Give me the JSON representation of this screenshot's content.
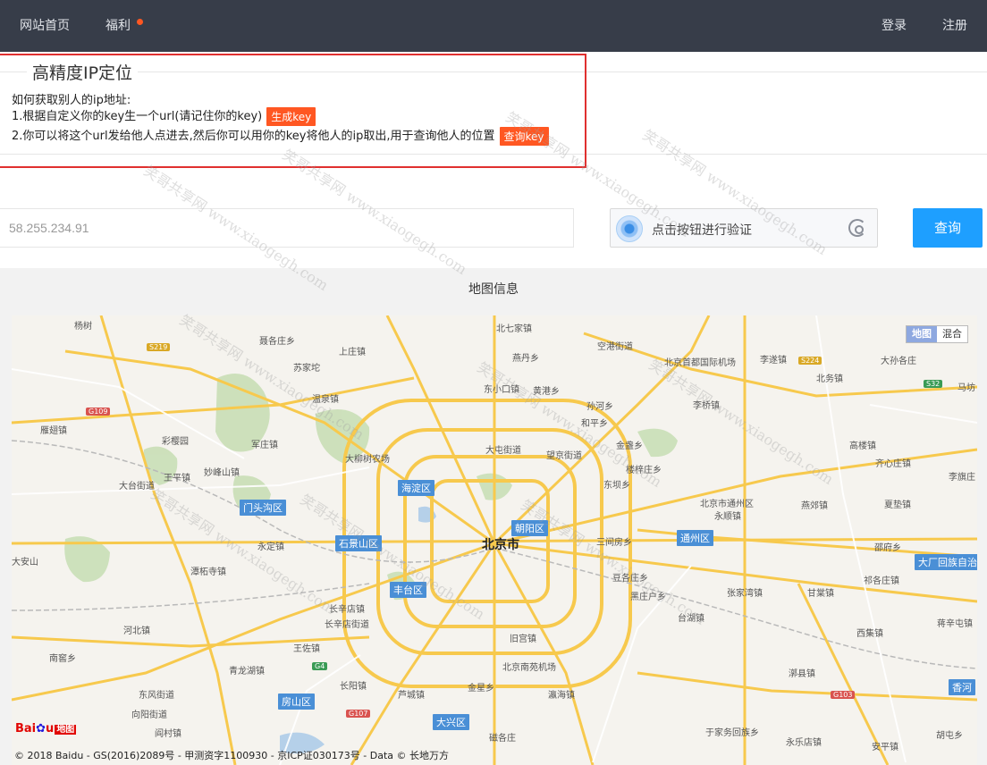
{
  "nav": {
    "home": "网站首页",
    "welfare": "福利",
    "login": "登录",
    "register": "注册"
  },
  "intro": {
    "title": "高精度IP定位",
    "question": "如何获取别人的ip地址:",
    "step1": "1.根据自定义你的key生一个url(请记住你的key)",
    "step1_button": "生成key",
    "step2": "2.你可以将这个url发给他人点进去,然后你可以用你的key将他人的ip取出,用于查询他人的位置",
    "step2_button": "查询key"
  },
  "query": {
    "ip_value": "58.255.234.91",
    "captcha_text": "点击按钮进行验证",
    "search_button": "查询"
  },
  "map": {
    "title": "地图信息",
    "type_map": "地图",
    "type_hybrid": "混合",
    "center_city": "北京市",
    "districts": [
      "海淀区",
      "门头沟区",
      "石景山区",
      "朝阳区",
      "丰台区",
      "通州区",
      "房山区",
      "大兴区",
      "大厂回族自治",
      "香河"
    ],
    "places": [
      "杨树",
      "北七家镇",
      "空港街道",
      "燕丹乡",
      "聂各庄乡",
      "上庄镇",
      "苏家坨",
      "北京首都国际机场",
      "李遂镇",
      "大孙各庄",
      "东小口镇",
      "黄港乡",
      "北务镇",
      "马坊",
      "温泉镇",
      "孙河乡",
      "李桥镇",
      "和平乡",
      "雁翅镇",
      "彩樱园",
      "军庄镇",
      "金盏乡",
      "高楼镇",
      "大屯街道",
      "望京街道",
      "大柳树农场",
      "齐心庄镇",
      "王平镇",
      "妙峰山镇",
      "楼梓庄乡",
      "大台街道",
      "东坝乡",
      "李旗庄",
      "北京市通州区",
      "永顺镇",
      "燕郊镇",
      "夏垫镇",
      "永定镇",
      "三间房乡",
      "邵府乡",
      "潭柘寺镇",
      "豆各庄乡",
      "黑庄户乡",
      "祁各庄镇",
      "张家湾镇",
      "甘棠镇",
      "长辛店镇",
      "长辛店街道",
      "台湖镇",
      "蒋辛屯镇",
      "河北镇",
      "王佐镇",
      "旧宫镇",
      "西集镇",
      "南窖乡",
      "青龙湖镇",
      "北京南苑机场",
      "漷县镇",
      "长阳镇",
      "金星乡",
      "瀛海镇",
      "东风街道",
      "芦城镇",
      "向阳街道",
      "阎村镇",
      "于家务回族乡",
      "永乐店镇",
      "磁各庄",
      "安平镇",
      "胡屯乡",
      "大安山"
    ],
    "highways": [
      "S219",
      "G109",
      "S224",
      "S32",
      "G4",
      "G107",
      "G103"
    ],
    "copyright": "© 2018 Baidu - GS(2016)2089号 - 甲测资字1100930 - 京ICP证030173号 - Data © 长地万方"
  },
  "watermark_text": "笑哥共享网 www.xiaogegh.com"
}
